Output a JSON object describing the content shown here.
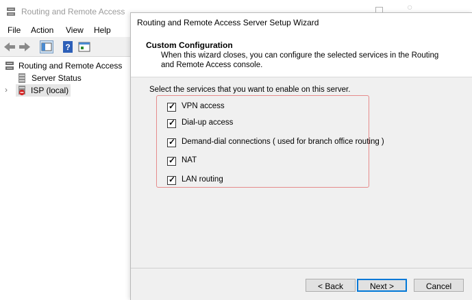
{
  "mmc": {
    "title": "Routing and Remote Access",
    "menu": [
      "File",
      "Action",
      "View",
      "Help"
    ],
    "tree": {
      "root": "Routing and Remote Access",
      "server_status": "Server Status",
      "server": "ISP (local)"
    }
  },
  "wizard": {
    "title": "Routing and Remote Access Server Setup Wizard",
    "heading": "Custom Configuration",
    "description": "When this wizard closes, you can configure the selected services in the Routing and Remote Access console.",
    "prompt": "Select the services that you want to enable on this server.",
    "services": [
      {
        "label": "VPN access",
        "checked": true
      },
      {
        "label": "Dial-up access",
        "checked": true
      },
      {
        "label": "Demand-dial connections ( used for branch office routing )",
        "checked": true
      },
      {
        "label": "NAT",
        "checked": true
      },
      {
        "label": "LAN routing",
        "checked": true
      }
    ],
    "buttons": {
      "back": "< Back",
      "next": "Next >",
      "cancel": "Cancel"
    }
  },
  "colors": {
    "highlight_border": "#e58a8a",
    "default_button_border": "#0078d7"
  }
}
